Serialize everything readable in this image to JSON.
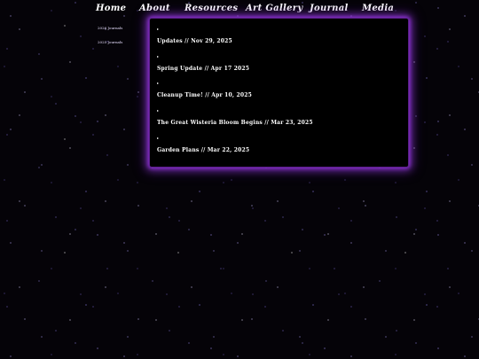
{
  "nav": {
    "home": "Home",
    "about": "About",
    "resources": "Resources",
    "gallery": "Art Gallery",
    "journal": "Journal",
    "media": "Media"
  },
  "sidebar": {
    "items": [
      {
        "label": "2026 Journals"
      },
      {
        "label": "2025 Journals"
      }
    ]
  },
  "journal": {
    "toggle_icon": "▸",
    "entries": [
      {
        "title": "Updates // Nov 29, 2025"
      },
      {
        "title": "Spring Update // Apr 17 2025"
      },
      {
        "title": "Cleanup Time! // Apr 10, 2025"
      },
      {
        "title": "The Great Wisteria Bloom Begins // Mar 23, 2025"
      },
      {
        "title": "Garden Plans // Mar 22, 2025"
      }
    ]
  },
  "colors": {
    "background": "#050308",
    "panel": "#000000",
    "glow": "#8b2fd0",
    "text": "#ffffff"
  }
}
